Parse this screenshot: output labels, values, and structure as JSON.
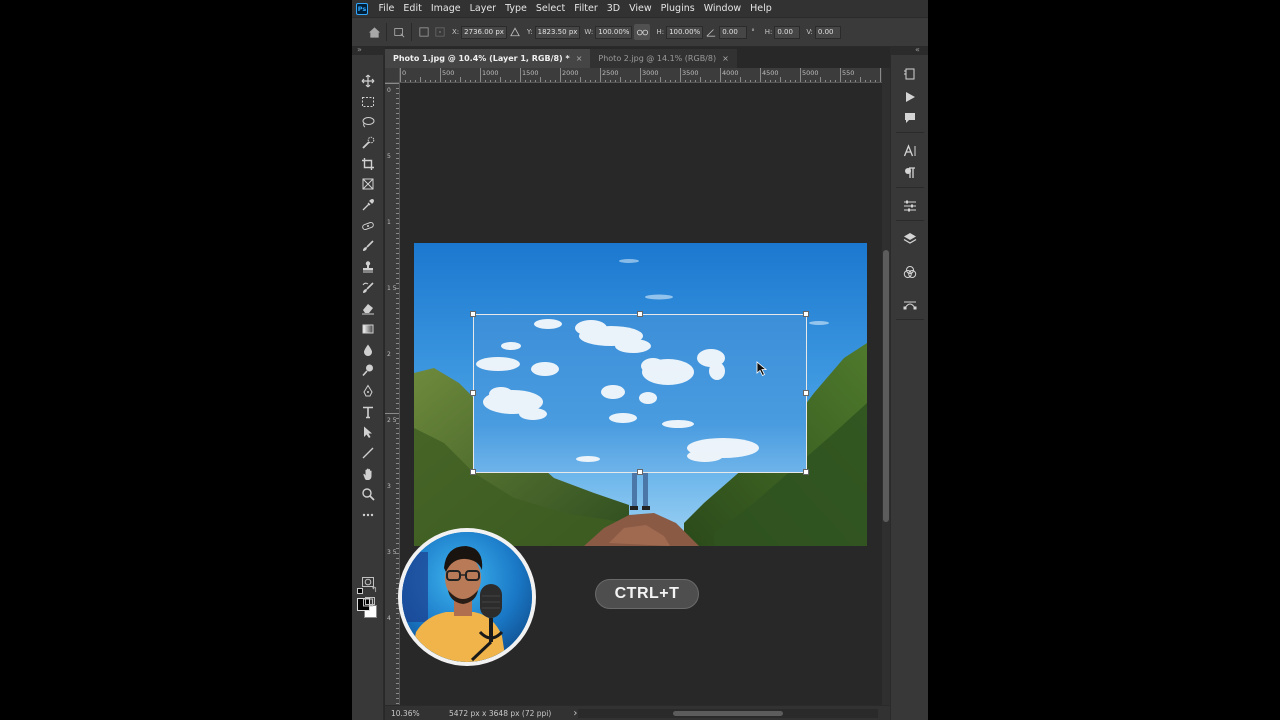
{
  "app": {
    "logo_text": "Ps"
  },
  "menu": [
    "File",
    "Edit",
    "Image",
    "Layer",
    "Type",
    "Select",
    "Filter",
    "3D",
    "View",
    "Plugins",
    "Window",
    "Help"
  ],
  "options": {
    "x_label": "X:",
    "x_value": "2736.00 px",
    "y_label": "Y:",
    "y_value": "1823.50 px",
    "w_label": "W:",
    "w_value": "100.00%",
    "h_label": "H:",
    "h_value": "100.00%",
    "angle_value": "0.00",
    "angle_unit": "°",
    "hskew_label": "H:",
    "hskew_value": "0.00",
    "vskew_label": "V:",
    "vskew_value": "0.00"
  },
  "tabs": [
    {
      "label": "Photo 1.jpg @ 10.4% (Layer 1, RGB/8) *",
      "active": true
    },
    {
      "label": "Photo 2.jpg @ 14.1% (RGB/8)",
      "active": false
    }
  ],
  "tab_close": "×",
  "ruler_h": [
    "0",
    "500",
    "1000",
    "1500",
    "2000",
    "2500",
    "3000",
    "3500",
    "4000",
    "4500",
    "5000",
    "550"
  ],
  "ruler_v": [
    "0",
    "5",
    "1",
    "1 5",
    "2",
    "2 5",
    "3",
    "3 5",
    "4"
  ],
  "status": {
    "zoom": "10.36%",
    "doc_info": "5472 px x 3648 px (72 ppi)",
    "arrow": "›"
  },
  "overlay": {
    "shortcut": "CTRL+T"
  },
  "icons": {
    "tools": [
      "move-icon",
      "marquee-icon",
      "lasso-icon",
      "quick-select-icon",
      "crop-icon",
      "frame-icon",
      "eyedropper-icon",
      "healing-icon",
      "brush-icon",
      "stamp-icon",
      "history-brush-icon",
      "eraser-icon",
      "gradient-icon",
      "blur-icon",
      "dodge-icon",
      "pen-icon",
      "type-icon",
      "path-select-icon",
      "line-icon",
      "hand-icon",
      "zoom-icon",
      "more-icon"
    ],
    "panels": [
      "history-icon",
      "play-icon",
      "comment-icon",
      "character-icon",
      "paragraph-icon",
      "adjustments-icon",
      "layers-icon",
      "channels-icon",
      "paths-icon"
    ]
  },
  "colors": {
    "accent": "#31a8ff",
    "canvas_bg": "#282828",
    "foreground": "#000000",
    "background": "#ffffff"
  }
}
